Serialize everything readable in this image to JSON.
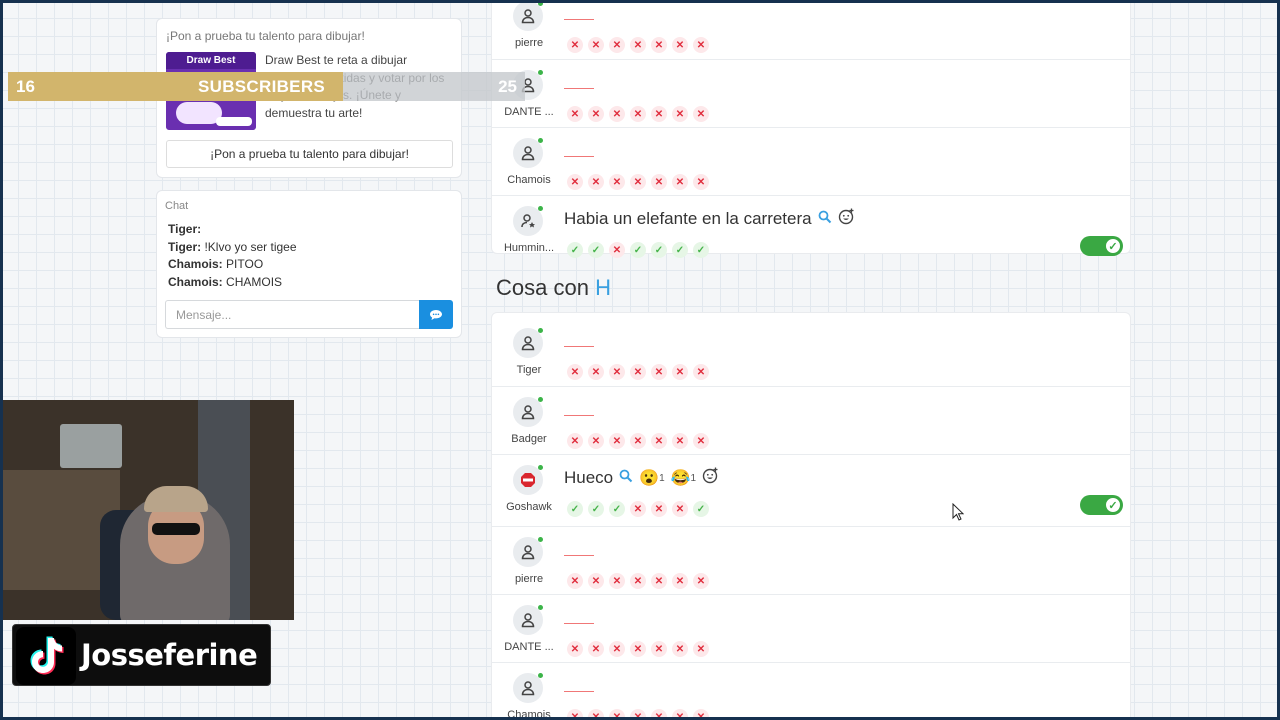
{
  "promo": {
    "title": "¡Pon a prueba tu talento para dibujar!",
    "image_label": "Draw Best",
    "image_tag": "Draw Best",
    "description": "Draw Best te reta a dibujar palabras divertidas y votar por los mejores dibujos. ¡Únete y demuestra tu arte!",
    "button": "¡Pon a prueba tu talento para dibujar!"
  },
  "overlay": {
    "count_left": "16",
    "label": "SUBSCRIBERS",
    "count_right": "25",
    "gold_color": "#d2b56c"
  },
  "chat": {
    "title": "Chat",
    "messages": [
      {
        "user": "Tiger:",
        "text": ""
      },
      {
        "user": "Tiger:",
        "text": "!Klvo yo ser tigee"
      },
      {
        "user": "Chamois:",
        "text": "PITOO"
      },
      {
        "user": "Chamois:",
        "text": "CHAMOIS"
      }
    ],
    "input_placeholder": "Mensaje...",
    "send_icon": "chat-bubble-icon"
  },
  "round1": {
    "rows": [
      {
        "player": "pierre",
        "answer": "",
        "marks": [
          "x",
          "x",
          "x",
          "x",
          "x",
          "x",
          "x"
        ],
        "avatar_icon": "user-icon"
      },
      {
        "player": "DANTE ...",
        "answer": "",
        "marks": [
          "x",
          "x",
          "x",
          "x",
          "x",
          "x",
          "x"
        ],
        "avatar_icon": "user-icon"
      },
      {
        "player": "Chamois",
        "answer": "",
        "marks": [
          "x",
          "x",
          "x",
          "x",
          "x",
          "x",
          "x"
        ],
        "avatar_icon": "user-icon"
      },
      {
        "player": "Hummin...",
        "answer": "Habia un elefante en la carretera",
        "marks": [
          "ok",
          "ok",
          "x",
          "ok",
          "ok",
          "ok",
          "ok"
        ],
        "avatar_icon": "user-star-icon",
        "valid": true
      }
    ]
  },
  "round2": {
    "category": "Cosa con",
    "letter": "H",
    "rows": [
      {
        "player": "Tiger",
        "answer": "",
        "marks": [
          "x",
          "x",
          "x",
          "x",
          "x",
          "x",
          "x"
        ],
        "avatar_icon": "user-icon"
      },
      {
        "player": "Badger",
        "answer": "",
        "marks": [
          "x",
          "x",
          "x",
          "x",
          "x",
          "x",
          "x"
        ],
        "avatar_icon": "user-icon"
      },
      {
        "player": "Goshawk",
        "answer": "Hueco",
        "reactions": [
          {
            "emoji": "😮",
            "count": "1"
          },
          {
            "emoji": "😂",
            "count": "1"
          }
        ],
        "marks": [
          "ok",
          "ok",
          "ok",
          "x",
          "x",
          "x",
          "ok"
        ],
        "avatar_icon": "stop-sign-icon",
        "valid": true
      },
      {
        "player": "pierre",
        "answer": "",
        "marks": [
          "x",
          "x",
          "x",
          "x",
          "x",
          "x",
          "x"
        ],
        "avatar_icon": "user-icon"
      },
      {
        "player": "DANTE ...",
        "answer": "",
        "marks": [
          "x",
          "x",
          "x",
          "x",
          "x",
          "x",
          "x"
        ],
        "avatar_icon": "user-icon"
      },
      {
        "player": "Chamois",
        "answer": "",
        "marks": [
          "x",
          "x",
          "x",
          "x",
          "x",
          "x",
          "x"
        ],
        "avatar_icon": "user-icon"
      }
    ]
  },
  "streamer": {
    "handle": "Josseferine",
    "platform_icon": "tiktok-icon"
  },
  "colors": {
    "accent": "#1a8fe0",
    "letter": "#39a0e0",
    "toggle_on": "#3aa843",
    "mark_wrong": "#e02e3e",
    "mark_right": "#46b34a",
    "frame": "#16314f"
  }
}
